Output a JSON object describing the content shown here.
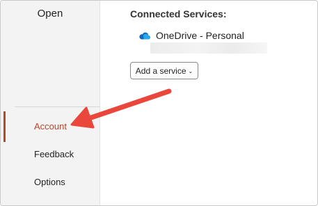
{
  "sidebar": {
    "items": [
      {
        "label": "Open"
      },
      {
        "label": "Account"
      },
      {
        "label": "Feedback"
      },
      {
        "label": "Options"
      }
    ],
    "selected": "Account",
    "accent_color": "#b7472a"
  },
  "main": {
    "section_title": "Connected Services:",
    "services": [
      {
        "name": "OneDrive - Personal",
        "icon": "onedrive-cloud-icon"
      }
    ],
    "add_service_label": "Add a service"
  },
  "annotation": {
    "arrow_color": "#e9473b",
    "points_to": "Account"
  }
}
